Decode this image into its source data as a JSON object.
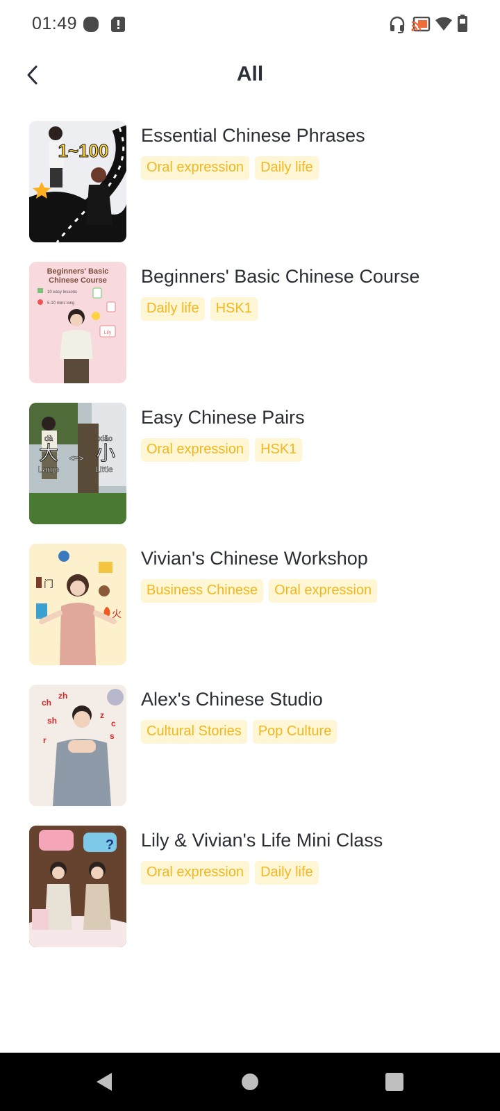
{
  "status_bar": {
    "time": "01:49",
    "left_icons": [
      "circle-notification-icon",
      "alert-notification-icon"
    ],
    "right_icons": [
      "headset-icon",
      "cast-icon",
      "wifi-icon",
      "battery-icon"
    ]
  },
  "header": {
    "title": "All",
    "back_icon": "chevron-left-icon"
  },
  "colors": {
    "tag_text": "#f2b71e",
    "tag_background": "#fff6d6",
    "title_text": "#2b2e35"
  },
  "courses": [
    {
      "title": "Essential Chinese Phrases",
      "tags": [
        "Oral expression",
        "Daily life"
      ],
      "thumb_text": [
        "1~100"
      ]
    },
    {
      "title": "Beginners' Basic Chinese Course",
      "tags": [
        "Daily life",
        "HSK1"
      ],
      "thumb_text": [
        "Beginners' Basic",
        "Chinese Course",
        "10 easy lessons",
        "5-10 mins long",
        "Lily"
      ]
    },
    {
      "title": "Easy Chinese Pairs",
      "tags": [
        "Oral expression",
        "HSK1"
      ],
      "thumb_text": [
        "dà",
        "大",
        "xiǎo",
        "小",
        "<=>",
        "Large",
        "Little"
      ]
    },
    {
      "title": "Vivian's Chinese Workshop",
      "tags": [
        "Business Chinese",
        "Oral expression"
      ],
      "thumb_text": [
        "门",
        "火"
      ]
    },
    {
      "title": "Alex's Chinese Studio",
      "tags": [
        "Cultural Stories",
        "Pop Culture"
      ],
      "thumb_text": [
        "ch",
        "zh",
        "sh",
        "r",
        "z",
        "c",
        "s"
      ]
    },
    {
      "title": "Lily & Vivian's Life Mini Class",
      "tags": [
        "Oral expression",
        "Daily life"
      ],
      "thumb_text": [
        "?"
      ]
    }
  ],
  "nav_bar": {
    "buttons": [
      "back-triangle-icon",
      "home-circle-icon",
      "recents-square-icon"
    ]
  }
}
